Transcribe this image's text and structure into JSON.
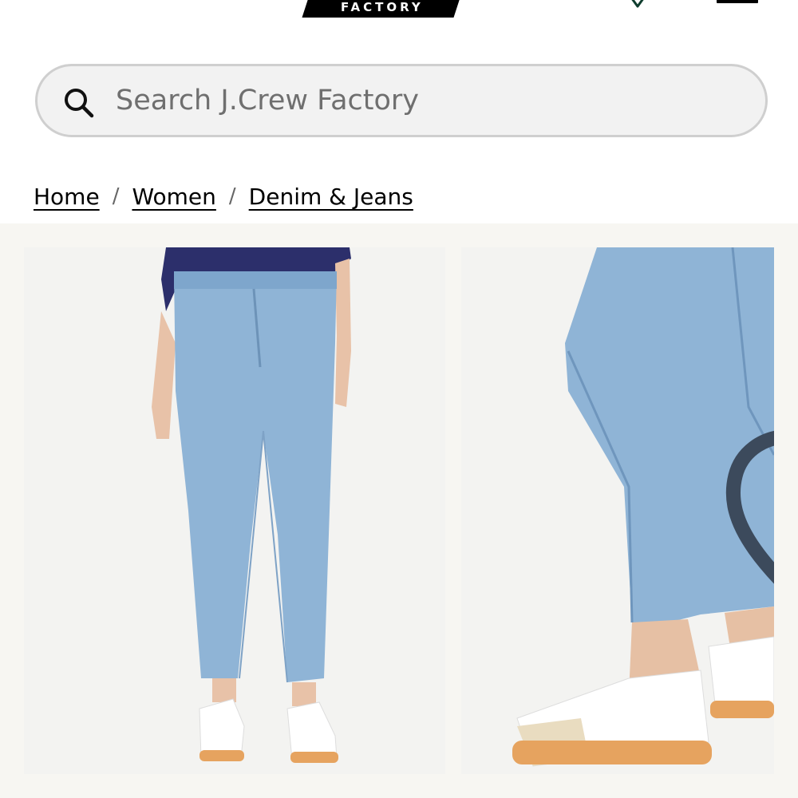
{
  "header": {
    "logo_text": "FACTORY",
    "wishlist_icon": "heart-outline-icon",
    "bag_icon": "shopping-bag-icon"
  },
  "search": {
    "placeholder": "Search J.Crew Factory",
    "value": "",
    "icon": "search-icon"
  },
  "breadcrumb": {
    "items": [
      {
        "label": "Home"
      },
      {
        "label": "Women"
      },
      {
        "label": "Denim & Jeans"
      }
    ],
    "separator": "/"
  },
  "gallery": {
    "images": [
      {
        "alt_name": "jeans-front-view"
      },
      {
        "alt_name": "jeans-hem-closeup"
      }
    ],
    "favorite_icon": "heart-outline-icon"
  },
  "colors": {
    "logo_bg": "#000000",
    "search_bg": "#f2f2f2",
    "gallery_bg": "#f7f6f2",
    "denim": "#8fb4d6",
    "sweater": "#2c2f6b",
    "sneaker_sole": "#e6a35f",
    "wishlist_green": "#0f3d2e"
  }
}
